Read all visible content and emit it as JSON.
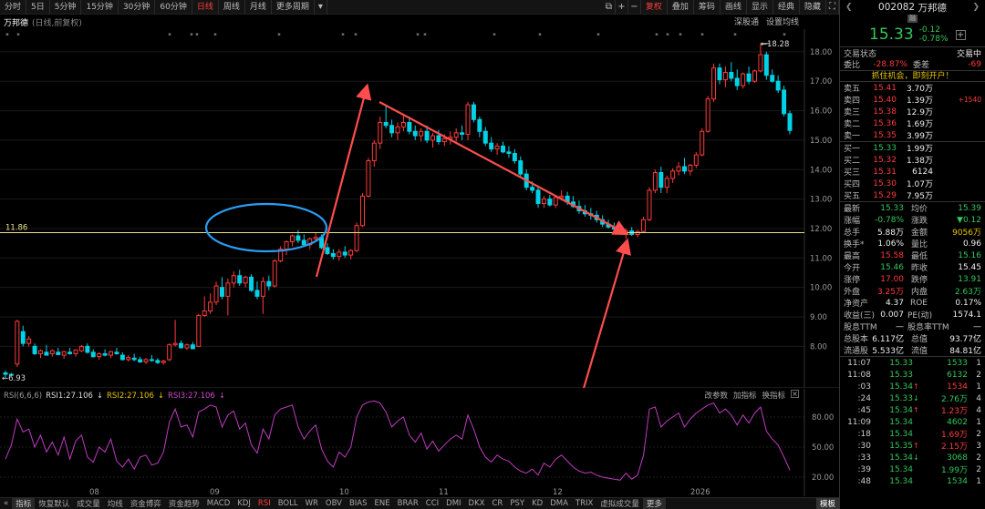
{
  "toolbar": {
    "items": [
      "分时",
      "5日",
      "5分钟",
      "15分钟",
      "30分钟",
      "60分钟",
      "日线",
      "周线",
      "月线",
      "更多周期"
    ],
    "active": "日线",
    "right": [
      "复权",
      "叠加",
      "筹码",
      "画线",
      "显示",
      "经典",
      "隐藏"
    ]
  },
  "chart_header": {
    "name": "万邦德",
    "sub": "(日线,前复权)",
    "right": [
      "深股通",
      "设置均线"
    ]
  },
  "price_axis": [
    "18.00",
    "17.00",
    "16.00",
    "15.00",
    "14.00",
    "13.00",
    "12.00",
    "11.00",
    "10.00",
    "9.00",
    "8.00"
  ],
  "h_line_label": "11.86",
  "high_label": "18.28",
  "low_label": "6.93",
  "x_labels": [
    "08",
    "09",
    "10",
    "11",
    "12",
    "2026"
  ],
  "rsi": {
    "header": {
      "title": "RSI(6,6,6)",
      "r1": "RSI1:27.106",
      "r2": "RSI2:27.106",
      "r3": "RSI3:27.106",
      "tools": [
        "改参数",
        "加指标",
        "换指标"
      ]
    },
    "axis": [
      "80.00",
      "50.00",
      "20.00"
    ]
  },
  "bottom_tabs": [
    "指标",
    "恢复默认",
    "成交量",
    "均线",
    "资金博弈",
    "资金趋势",
    "MACD",
    "KDJ",
    "RSI",
    "BOLL",
    "WR",
    "OBV",
    "BIAS",
    "ENE",
    "BRAR",
    "CCI",
    "DMI",
    "DKX",
    "CR",
    "PSY",
    "KD",
    "DMA",
    "TRIX",
    "虚拟成交量",
    "更多",
    "模板"
  ],
  "bottom_active": "RSI",
  "panel": {
    "code": "002082",
    "name": "万邦德",
    "badge": "融",
    "price": "15.33",
    "chg": "-0.12",
    "pct": "-0.78%",
    "status_label": "交易状态",
    "status": "交易中",
    "weibi_l": "委比",
    "weibi": "-28.87%",
    "weicha_l": "委差",
    "weicha": "-69",
    "promo": "抓住机会，即刻开户！",
    "sells": [
      {
        "l": "卖五",
        "p": "15.41",
        "v": "3.70万",
        "x": ""
      },
      {
        "l": "卖四",
        "p": "15.40",
        "v": "1.39万",
        "x": "+1540"
      },
      {
        "l": "卖三",
        "p": "15.38",
        "v": "12.9万",
        "x": ""
      },
      {
        "l": "卖二",
        "p": "15.36",
        "v": "1.69万",
        "x": ""
      },
      {
        "l": "卖一",
        "p": "15.35",
        "v": "3.99万",
        "x": ""
      }
    ],
    "buys": [
      {
        "l": "买一",
        "p": "15.33",
        "v": "1.99万"
      },
      {
        "l": "买二",
        "p": "15.32",
        "v": "1.38万"
      },
      {
        "l": "买三",
        "p": "15.31",
        "v": "6124"
      },
      {
        "l": "买四",
        "p": "15.30",
        "v": "1.07万"
      },
      {
        "l": "买五",
        "p": "15.29",
        "v": "7.95万"
      }
    ],
    "stats": [
      [
        "最新",
        "15.33",
        "均价",
        "15.39"
      ],
      [
        "涨幅",
        "-0.78%",
        "涨跌",
        "▼0.12"
      ],
      [
        "总手",
        "5.88万",
        "金额",
        "9056万"
      ],
      [
        "换手*",
        "1.06%",
        "量比",
        "0.96"
      ],
      [
        "最高",
        "15.58",
        "最低",
        "15.16"
      ],
      [
        "今开",
        "15.46",
        "昨收",
        "15.45"
      ],
      [
        "涨停",
        "17.00",
        "跌停",
        "13.91"
      ],
      [
        "外盘",
        "3.25万",
        "内盘",
        "2.63万"
      ],
      [
        "净资产",
        "4.37",
        "ROE",
        "0.17%"
      ],
      [
        "收益(三)",
        "0.007",
        "PE(动)",
        "1574.1"
      ],
      [
        "股息TTM",
        "—",
        "股息率TTM",
        "—"
      ],
      [
        "总股本",
        "6.117亿",
        "总值",
        "93.77亿"
      ],
      [
        "流通股",
        "5.533亿",
        "流值",
        "84.81亿"
      ]
    ],
    "trades": [
      {
        "t": "11:07",
        "p": "15.33",
        "a": "",
        "v": "1533",
        "n": "1",
        "pc": "g",
        "vc": "g"
      },
      {
        "t": "11:08",
        "p": "15.33",
        "a": "",
        "v": "6132",
        "n": "2",
        "pc": "g",
        "vc": "g"
      },
      {
        "t": ":03",
        "p": "15.34",
        "a": "↑",
        "v": "1534",
        "n": "1",
        "pc": "g",
        "vc": "r"
      },
      {
        "t": ":24",
        "p": "15.33",
        "a": "↓",
        "v": "2.76万",
        "n": "4",
        "pc": "g",
        "vc": "g"
      },
      {
        "t": ":45",
        "p": "15.34",
        "a": "↑",
        "v": "1.23万",
        "n": "4",
        "pc": "g",
        "vc": "r"
      },
      {
        "t": "11:09",
        "p": "15.34",
        "a": "",
        "v": "4602",
        "n": "1",
        "pc": "g",
        "vc": "g"
      },
      {
        "t": ":18",
        "p": "15.34",
        "a": "",
        "v": "1.69万",
        "n": "2",
        "pc": "g",
        "vc": "r"
      },
      {
        "t": ":30",
        "p": "15.35",
        "a": "↑",
        "v": "2.15万",
        "n": "3",
        "pc": "g",
        "vc": "r"
      },
      {
        "t": ":33",
        "p": "15.34",
        "a": "↓",
        "v": "3068",
        "n": "2",
        "pc": "g",
        "vc": "g"
      },
      {
        "t": ":39",
        "p": "15.34",
        "a": "",
        "v": "1.99万",
        "n": "2",
        "pc": "g",
        "vc": "g"
      },
      {
        "t": ":48",
        "p": "15.34",
        "a": "",
        "v": "1534",
        "n": "1",
        "pc": "g",
        "vc": "g"
      }
    ]
  },
  "colors": {
    "up": "#ff3b3b",
    "down": "#00d2e6",
    "rsi": "#c03cc0",
    "hline": "#e8e18a",
    "annot_blue": "#2a9df4",
    "annot_red": "#ff4d4d"
  }
}
